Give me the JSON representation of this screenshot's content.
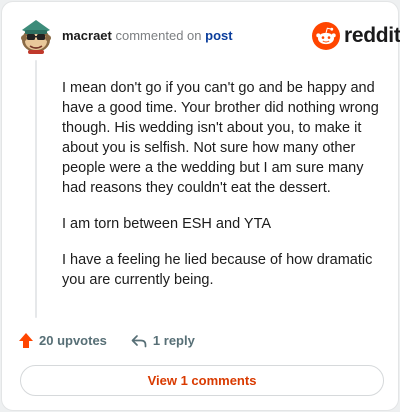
{
  "header": {
    "username": "macraet",
    "action_text": "commented on",
    "post_link": "post"
  },
  "logo": {
    "icon": "reddit-snoo-icon",
    "wordmark": "reddit",
    "brand_color": "#ff4500"
  },
  "comment": {
    "paragraphs": [
      "I mean don't go if you can't go and be happy and have a good time. Your brother did nothing wrong though. His wedding isn't about you, to make it about you is selfish. Not sure how many other people were a the wedding but I am sure many had reasons they couldn't eat the dessert.",
      "I am torn between ESH and YTA",
      "I have a feeling he lied because of how dramatic you are currently being."
    ]
  },
  "actions": {
    "upvotes_label": "20 upvotes",
    "reply_label": "1 reply",
    "upvote_icon": "upvote-arrow-icon",
    "reply_icon": "reply-arrow-icon"
  },
  "footer": {
    "view_comments_label": "View 1 comments",
    "accent_color": "#d93a00"
  }
}
